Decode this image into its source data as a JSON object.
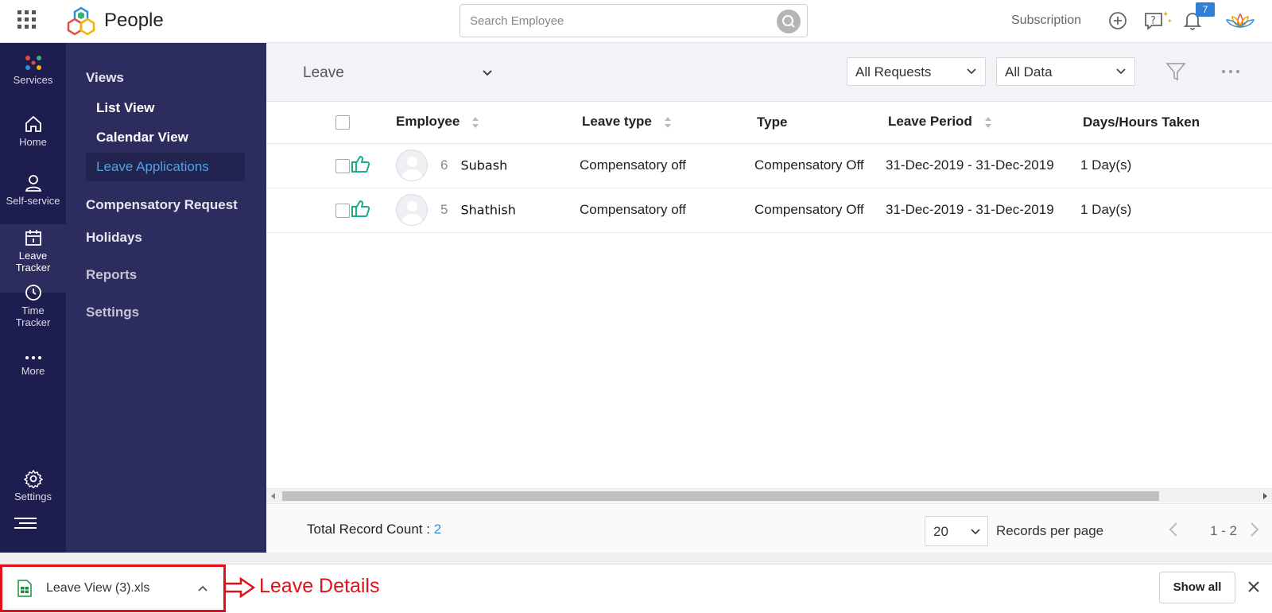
{
  "app": {
    "name": "People"
  },
  "search": {
    "placeholder": "Search Employee"
  },
  "topbar": {
    "subscription_label": "Subscription",
    "notification_count": "7"
  },
  "rail": {
    "items": [
      {
        "label": "Services",
        "icon": "services-dots-icon"
      },
      {
        "label": "Home",
        "icon": "home-icon"
      },
      {
        "label": "Self-service",
        "icon": "user-icon"
      },
      {
        "label": "Leave",
        "label2": "Tracker",
        "icon": "calendar-icon"
      },
      {
        "label": "Time",
        "label2": "Tracker",
        "icon": "clock-icon"
      },
      {
        "label": "More",
        "icon": "more-dots-icon"
      },
      {
        "label": "Settings",
        "icon": "gear-icon"
      }
    ]
  },
  "subnav": {
    "views_label": "Views",
    "views": [
      "List View",
      "Calendar View",
      "Leave Applications"
    ],
    "compensatory_label": "Compensatory Request",
    "holidays_label": "Holidays",
    "reports_label": "Reports",
    "settings_label": "Settings"
  },
  "content": {
    "view_title": "Leave",
    "filter_requests": "All Requests",
    "filter_data": "All Data"
  },
  "table": {
    "headers": [
      "Employee",
      "Leave type",
      "Type",
      "Leave Period",
      "Days/Hours Taken"
    ],
    "rows": [
      {
        "id": "6",
        "name": "Subash",
        "leave_type": "Compensatory off",
        "type": "Compensatory Off",
        "period": "31-Dec-2019 - 31-Dec-2019",
        "days": "1 Day(s)"
      },
      {
        "id": "5",
        "name": "Shathish",
        "leave_type": "Compensatory off",
        "type": "Compensatory Off",
        "period": "31-Dec-2019 - 31-Dec-2019",
        "days": "1 Day(s)"
      }
    ]
  },
  "footer": {
    "total_label": "Total Record Count :",
    "total_count": "2",
    "per_page": "20",
    "records_per_page_label": "Records per page",
    "pager_text": "1 - 2"
  },
  "download": {
    "file_name": "Leave View (3).xls",
    "annotation": "Leave Details",
    "show_all": "Show all"
  },
  "colors": {
    "rail_bg": "#1d1d4f",
    "subnav_bg": "#2c2c5e",
    "accent_blue": "#4fa3e3",
    "approve_green": "#1aaa8c",
    "annotation_red": "#e2101a"
  }
}
